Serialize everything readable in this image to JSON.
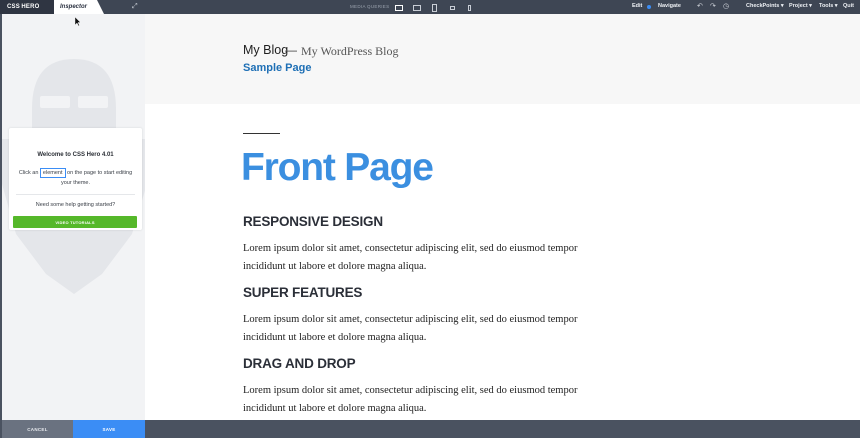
{
  "topbar": {
    "brand": "CSS HERO",
    "inspector_tab": "Inspector",
    "media_label": "MEDIA QUERIES",
    "edit_label": "Edit",
    "navigate_label": "Navigate",
    "checkpoints": "CheckPoints ▾",
    "project": "Project ▾",
    "tools": "Tools ▾",
    "quit": "Quit",
    "icons": [
      "expand-icon",
      "desktop-icon",
      "laptop-icon",
      "tablet-icon",
      "tablet-landscape-icon",
      "phone-icon",
      "undo-icon",
      "redo-icon",
      "history-icon"
    ],
    "colors": {
      "bar": "#3e4654",
      "accent": "#3b8df5"
    }
  },
  "sidebar": {
    "welcome_title": "Welcome to CSS Hero  4.01",
    "body_pre": "Click an ",
    "element_chip": "element",
    "body_post": " on the page to start editing your theme.",
    "help_text": "Need some help getting started?",
    "video_button": "VIDEO TUTORIALS",
    "colors": {
      "video": "#55b82a"
    }
  },
  "bottombar": {
    "cancel": "CANCEL",
    "save": "SAVE"
  },
  "preview": {
    "site_title": "My Blog",
    "title_sep": "—",
    "tagline": "My WordPress Blog",
    "nav_item": "Sample Page",
    "page_heading": "Front Page",
    "sections": [
      {
        "heading": "RESPONSIVE DESIGN",
        "text": "Lorem ipsum dolor sit amet, consectetur adipiscing elit, sed do eiusmod tempor incididunt ut labore et dolore magna aliqua."
      },
      {
        "heading": "SUPER FEATURES",
        "text": "Lorem ipsum dolor sit amet, consectetur adipiscing elit, sed do eiusmod tempor incididunt ut labore et dolore magna aliqua."
      },
      {
        "heading": "DRAG AND DROP",
        "text": "Lorem ipsum dolor sit amet, consectetur adipiscing elit, sed do eiusmod tempor incididunt ut labore et dolore magna aliqua."
      }
    ],
    "colors": {
      "heading": "#3b8fe0",
      "link": "#1e6fb5"
    }
  }
}
